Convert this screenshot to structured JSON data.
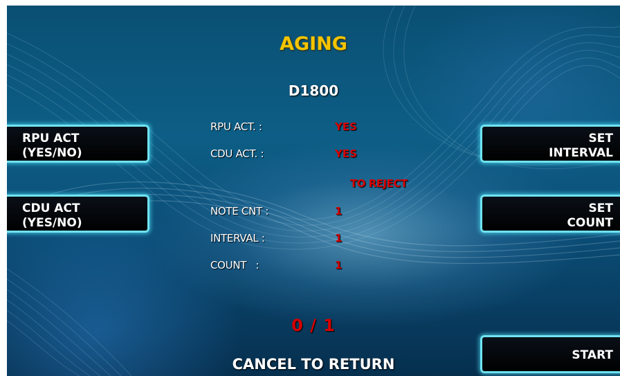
{
  "screen": {
    "title": "AGING",
    "model": "D1800",
    "progress": "0 / 1",
    "footer": "CANCEL TO RETURN"
  },
  "left_keys": [
    {
      "line1": "RPU ACT",
      "line2": "(YES/NO)"
    },
    {
      "line1": "CDU ACT",
      "line2": "(YES/NO)"
    }
  ],
  "right_keys": [
    {
      "line1": "SET",
      "line2": "INTERVAL"
    },
    {
      "line1": "SET",
      "line2": "COUNT"
    },
    {
      "line1": "START"
    }
  ],
  "status": {
    "rpu_label": "RPU ACT. :",
    "rpu_value": "YES",
    "cdu_label": "CDU ACT. :",
    "cdu_value": "YES",
    "mode": "TO REJECT",
    "note_cnt_label": "NOTE CNT :",
    "note_cnt_value": "1",
    "interval_label": "INTERVAL :",
    "interval_value": "1",
    "count_label": "COUNT   :",
    "count_value": "1"
  },
  "colors": {
    "title": "#f5c400",
    "value": "#d40000",
    "button_border": "#6fe3f2",
    "background": "#0b4e78"
  }
}
